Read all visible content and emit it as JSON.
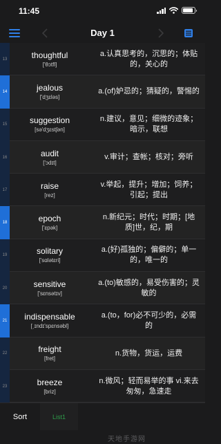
{
  "status": {
    "time": "11:45"
  },
  "nav": {
    "title": "Day 1"
  },
  "rows": [
    {
      "num": "13",
      "word": "thoughtful",
      "phonetic": "['θɔtfl]",
      "definition": "a.认真思考的，沉思的；体贴的，关心的",
      "active": false
    },
    {
      "num": "14",
      "word": "jealous",
      "phonetic": "['dʒɛləs]",
      "definition": "a.(of)妒忌的；猜疑的，警惕的",
      "active": true
    },
    {
      "num": "15",
      "word": "suggestion",
      "phonetic": "[sə'dʒɛstʃən]",
      "definition": "n.建议，意见；细微的迹象；暗示，联想",
      "active": false
    },
    {
      "num": "16",
      "word": "audit",
      "phonetic": "['ɔdɪt]",
      "definition": "v.审计；查帐；核对；旁听",
      "active": false
    },
    {
      "num": "17",
      "word": "raise",
      "phonetic": "[rez]",
      "definition": "v.举起，提升；增加；饲养；引起；提出",
      "active": false
    },
    {
      "num": "18",
      "word": "epoch",
      "phonetic": "['ɛpək]",
      "definition": "n.新纪元；时代；时期；[地质]世，纪，期",
      "active": true
    },
    {
      "num": "19",
      "word": "solitary",
      "phonetic": "['sɑlətɛri]",
      "definition": "a.(好)孤独的；偏僻的；单一的，唯一的",
      "active": false
    },
    {
      "num": "20",
      "word": "sensitive",
      "phonetic": "['sɛnsətɪv]",
      "definition": "a.(to)敏感的，易受伤害的；灵敏的",
      "active": false
    },
    {
      "num": "21",
      "word": "indispensable",
      "phonetic": "[ˌɪndɪ'spɛnsəbl]",
      "definition": "a.(to，for)必不可少的，必需的",
      "active": true
    },
    {
      "num": "22",
      "word": "freight",
      "phonetic": "[fret]",
      "definition": "n.货物，货运，运费",
      "active": false
    },
    {
      "num": "23",
      "word": "breeze",
      "phonetic": "[briz]",
      "definition": "n.微风；轻而易举的事 vi.来去匆匆，急速走",
      "active": false
    }
  ],
  "tabs": {
    "sort": "Sort",
    "list1": "List1"
  },
  "watermark": "天地手游网",
  "colors": {
    "accent": "#1f6fd8",
    "background": "#1b1b1c",
    "tab_active": "#2e9b4a"
  }
}
